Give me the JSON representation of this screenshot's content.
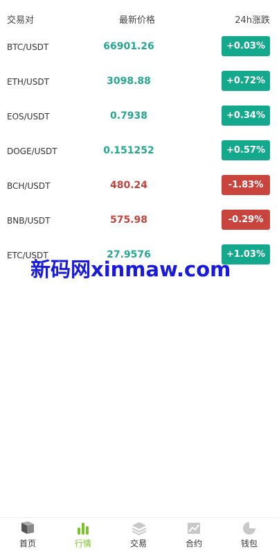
{
  "header": {
    "pair_label": "交易对",
    "price_label": "最新价格",
    "change_label": "24h涨跌"
  },
  "rows": [
    {
      "pair": "BTC/USDT",
      "price": "66901.26",
      "change": "+0.03%",
      "direction": "up"
    },
    {
      "pair": "ETH/USDT",
      "price": "3098.88",
      "change": "+0.72%",
      "direction": "up"
    },
    {
      "pair": "EOS/USDT",
      "price": "0.7938",
      "change": "+0.34%",
      "direction": "up"
    },
    {
      "pair": "DOGE/USDT",
      "price": "0.151252",
      "change": "+0.57%",
      "direction": "up"
    },
    {
      "pair": "BCH/USDT",
      "price": "480.24",
      "change": "-1.83%",
      "direction": "down"
    },
    {
      "pair": "BNB/USDT",
      "price": "575.98",
      "change": "-0.29%",
      "direction": "down"
    },
    {
      "pair": "ETC/USDT",
      "price": "27.9576",
      "change": "+1.03%",
      "direction": "up"
    }
  ],
  "watermark": "新码网xinmaw.com",
  "tabbar": {
    "items": [
      {
        "label": "首页",
        "icon": "home-icon"
      },
      {
        "label": "行情",
        "icon": "market-chart-icon"
      },
      {
        "label": "交易",
        "icon": "layers-icon"
      },
      {
        "label": "合约",
        "icon": "image-chart-icon"
      },
      {
        "label": "钱包",
        "icon": "pie-icon"
      }
    ]
  },
  "colors": {
    "up": "#14a88c",
    "down": "#c8443c",
    "tab_active": "#7cc22f"
  }
}
